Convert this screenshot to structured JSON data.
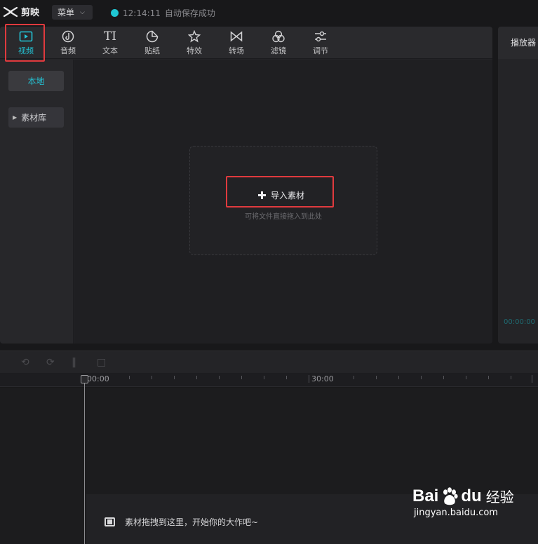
{
  "app": {
    "title": "剪映"
  },
  "header": {
    "menu_label": "菜单",
    "autosave_time": "12:14:11",
    "autosave_text": "自动保存成功"
  },
  "toolbar": {
    "items": [
      {
        "label": "视频",
        "icon": "video-icon",
        "active": true
      },
      {
        "label": "音频",
        "icon": "audio-icon"
      },
      {
        "label": "文本",
        "icon": "text-icon"
      },
      {
        "label": "贴纸",
        "icon": "sticker-icon"
      },
      {
        "label": "特效",
        "icon": "effects-icon"
      },
      {
        "label": "转场",
        "icon": "transition-icon"
      },
      {
        "label": "滤镜",
        "icon": "filter-icon"
      },
      {
        "label": "调节",
        "icon": "adjust-icon"
      }
    ]
  },
  "sidebar": {
    "local_label": "本地",
    "library_label": "素材库"
  },
  "media": {
    "import_label": "导入素材",
    "drop_hint": "可将文件直接拖入到此处"
  },
  "player": {
    "title": "播放器",
    "time": "00:00:00"
  },
  "timeline": {
    "start_label": "00:00",
    "mid_label": "30:00",
    "drop_hint": "素材拖拽到这里，开始你的大作吧~"
  },
  "watermark": {
    "brand_left": "Bai",
    "brand_right": "du",
    "brand_cn": "经验",
    "url": "jingyan.baidu.com"
  },
  "colors": {
    "accent": "#23c4d6",
    "highlight": "#e03a3e",
    "background": "#18181a"
  }
}
